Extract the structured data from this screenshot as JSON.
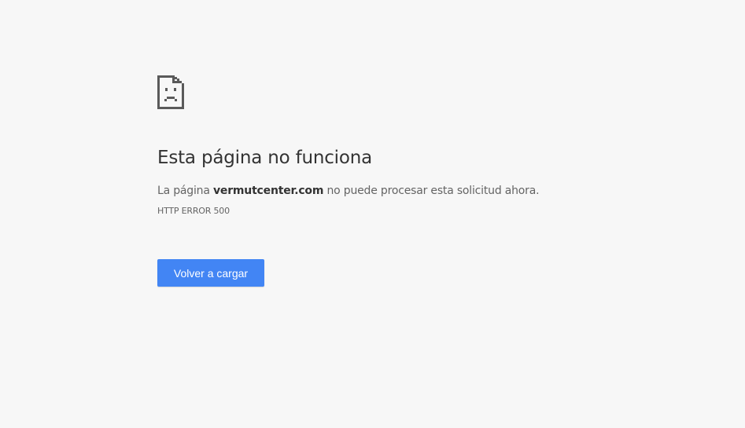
{
  "error": {
    "icon": "sad-page-icon",
    "title": "Esta página no funciona",
    "desc_prefix": "La página ",
    "domain": "vermutcenter.com",
    "desc_suffix": " no puede procesar esta solicitud ahora.",
    "code": "HTTP ERROR 500"
  },
  "actions": {
    "reload_label": "Volver a cargar"
  },
  "colors": {
    "background": "#f7f7f7",
    "button": "#4285f4",
    "icon": "#5a5a5a"
  }
}
